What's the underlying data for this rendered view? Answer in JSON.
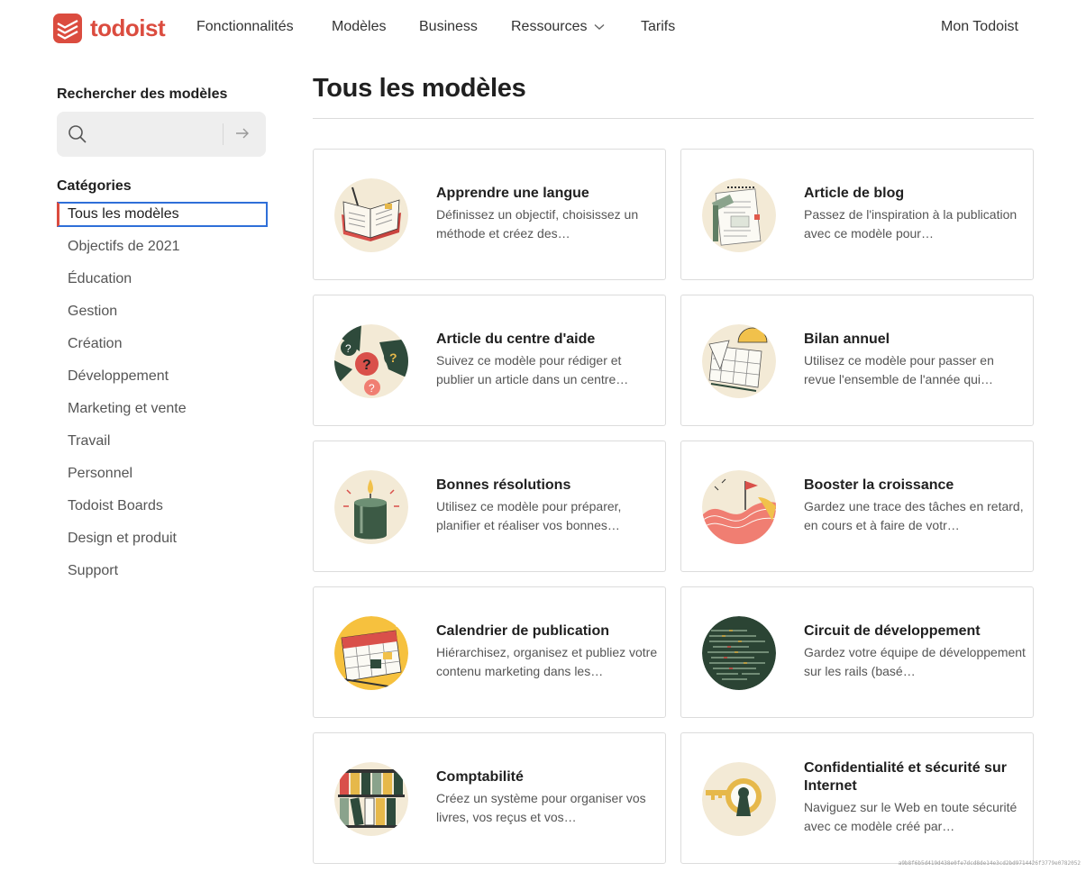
{
  "brand": {
    "name": "todoist",
    "color": "#db4c3f"
  },
  "nav": {
    "items": [
      {
        "label": "Fonctionnalités"
      },
      {
        "label": "Modèles"
      },
      {
        "label": "Business"
      },
      {
        "label": "Ressources",
        "has_dropdown": true
      },
      {
        "label": "Tarifs"
      }
    ],
    "account_link": "Mon Todoist"
  },
  "sidebar": {
    "search_title": "Rechercher des modèles",
    "search_placeholder": "",
    "search_icon": "magnifier-icon",
    "submit_icon": "arrow-right-icon",
    "categories_title": "Catégories",
    "categories": [
      {
        "label": "Tous les modèles",
        "active": true
      },
      {
        "label": "Objectifs de 2021"
      },
      {
        "label": "Éducation"
      },
      {
        "label": "Gestion"
      },
      {
        "label": "Création"
      },
      {
        "label": "Développement"
      },
      {
        "label": "Marketing et vente"
      },
      {
        "label": "Travail"
      },
      {
        "label": "Personnel"
      },
      {
        "label": "Todoist Boards"
      },
      {
        "label": "Design et produit"
      },
      {
        "label": "Support"
      }
    ]
  },
  "main": {
    "title": "Tous les modèles",
    "templates": [
      {
        "title": "Apprendre une langue",
        "description": "Définissez un objectif, choisissez un méthode et créez des…",
        "art": "open-book-illustration"
      },
      {
        "title": "Article de blog",
        "description": "Passez de l'inspiration à la publication avec ce modèle pour…",
        "art": "notepad-illustration"
      },
      {
        "title": "Article du centre d'aide",
        "description": "Suivez ce modèle pour rédiger et publier un article dans un centre…",
        "art": "question-bubbles-illustration"
      },
      {
        "title": "Bilan annuel",
        "description": "Utilisez ce modèle pour passer en revue l'ensemble de l'année qui…",
        "art": "calendar-sunset-illustration"
      },
      {
        "title": "Bonnes résolutions",
        "description": "Utilisez ce modèle pour préparer, planifier et réaliser vos bonnes…",
        "art": "candle-illustration"
      },
      {
        "title": "Booster la croissance",
        "description": "Gardez une trace des tâches en retard, en cours et à faire de votr…",
        "art": "flag-hill-illustration"
      },
      {
        "title": "Calendrier de publication",
        "description": "Hiérarchisez, organisez et publiez votre contenu marketing dans les…",
        "art": "calendar-illustration"
      },
      {
        "title": "Circuit de développement",
        "description": "Gardez votre équipe de développement sur les rails (basé…",
        "art": "code-lines-illustration"
      },
      {
        "title": "Comptabilité",
        "description": "Créez un système pour organiser vos livres, vos reçus et vos…",
        "art": "binders-illustration"
      },
      {
        "title": "Confidentialité et sécurité sur Internet",
        "description": "Naviguez sur le Web en toute sécurité avec ce modèle créé par…",
        "art": "keyhole-illustration"
      }
    ]
  },
  "watermark": "a9b8f6b5d419d438e0fe7dcd8de14e3cd2bd9714426f3779e0782052"
}
